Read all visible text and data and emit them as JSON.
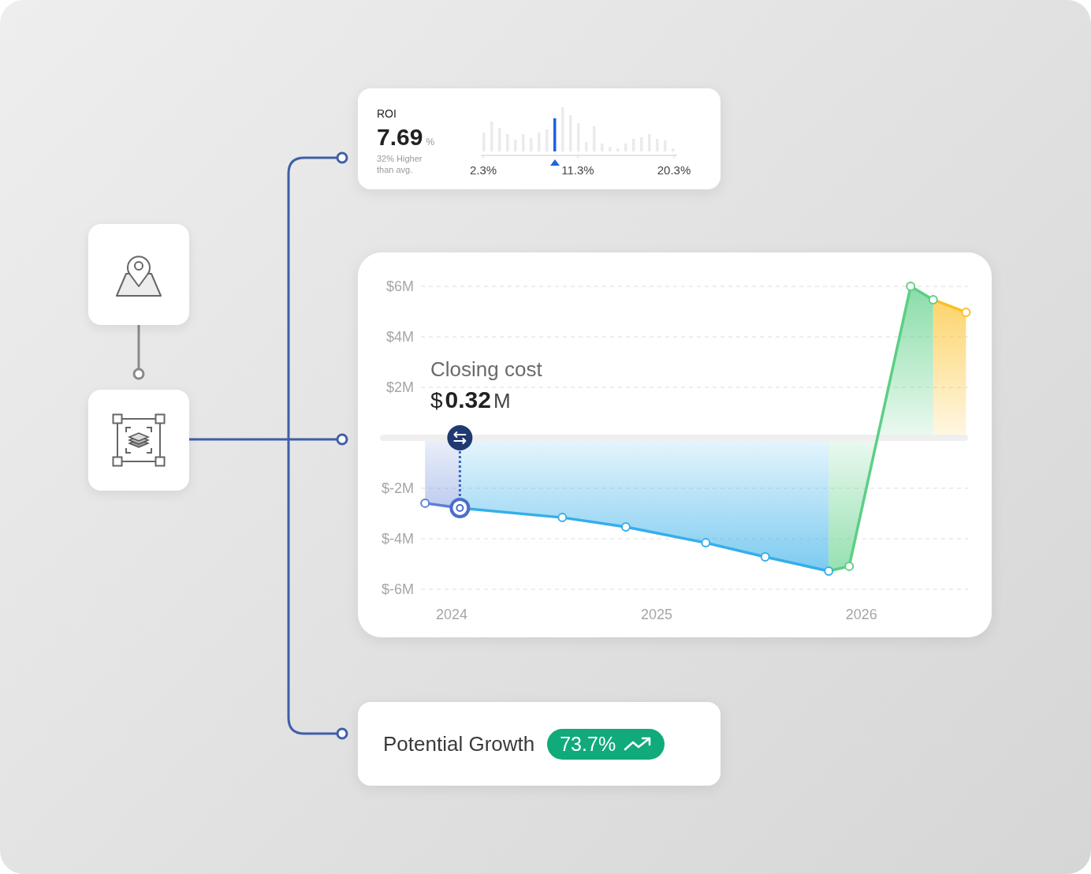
{
  "roi_card": {
    "title": "ROI",
    "value": "7.69",
    "unit": "%",
    "comparison": "32% Higher than avg.",
    "axis_labels": [
      "2.3%",
      "11.3%",
      "20.3%"
    ]
  },
  "cost_chart": {
    "label": "Closing cost",
    "currency": "$",
    "amount": "0.32",
    "unit": "M",
    "chart_data": {
      "type": "area",
      "x": [
        2023.87,
        2024.04,
        2024.54,
        2024.85,
        2025.24,
        2025.53,
        2025.84,
        2025.94,
        2026.24,
        2026.35,
        2026.51
      ],
      "series": [
        {
          "color": "#5b7fd6",
          "values": [
            -2.59,
            -2.78,
            null,
            null,
            null,
            null,
            null,
            null,
            null,
            null,
            null
          ]
        },
        {
          "color": "#35aee9",
          "values": [
            null,
            -2.78,
            -3.16,
            -3.53,
            -4.16,
            -4.72,
            -5.28,
            null,
            null,
            null,
            null
          ]
        },
        {
          "color": "#5ccf86",
          "values": [
            null,
            null,
            null,
            null,
            null,
            null,
            -5.28,
            -5.09,
            6.0,
            5.47,
            null
          ]
        },
        {
          "color": "#fbbf24",
          "values": [
            null,
            null,
            null,
            null,
            null,
            null,
            null,
            null,
            null,
            5.47,
            4.97
          ]
        }
      ],
      "xlim": [
        2023.85,
        2026.52
      ],
      "ylim": [
        -6,
        6
      ],
      "grid": true,
      "ref_lines": [
        {
          "value": 0,
          "axis": "y"
        }
      ],
      "xticks": [
        2024,
        2025,
        2026
      ],
      "yticks": [
        {
          "value": 6,
          "label": "$6M"
        },
        {
          "value": 4,
          "label": "$4M"
        },
        {
          "value": 2,
          "label": "$2M"
        },
        {
          "value": -2,
          "label": "$-2M"
        },
        {
          "value": -4,
          "label": "$-4M"
        },
        {
          "value": -6,
          "label": "$-6M"
        }
      ]
    }
  },
  "growth_card": {
    "label": "Potential Growth",
    "value": "73.7%"
  }
}
